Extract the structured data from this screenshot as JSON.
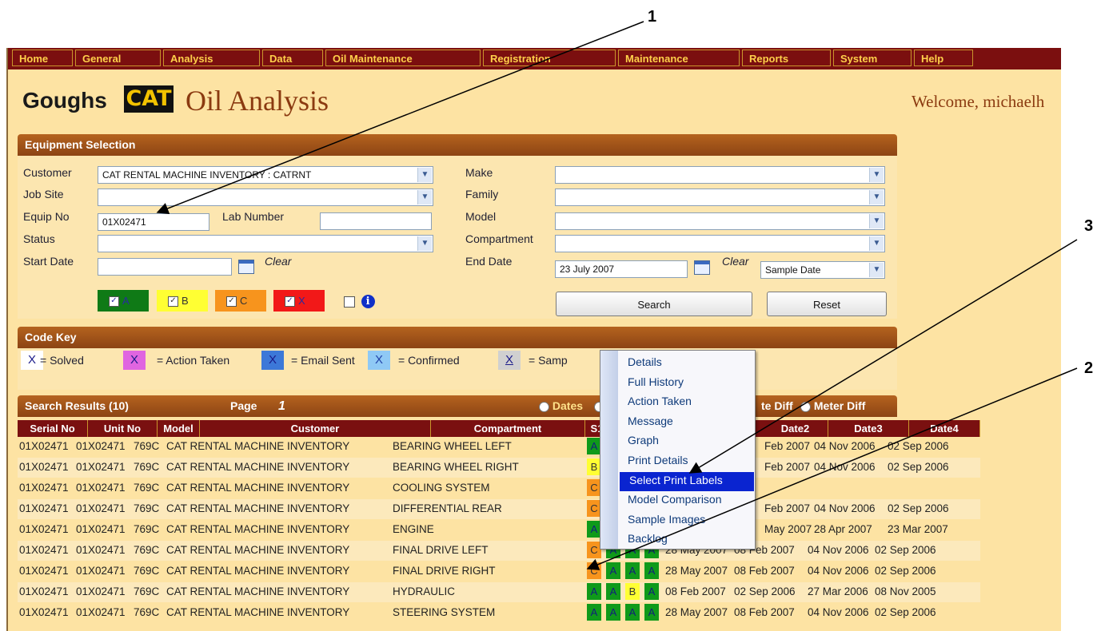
{
  "menu": [
    "Home",
    "General",
    "Analysis",
    "Data",
    "Oil Maintenance",
    "Registration",
    "Maintenance",
    "Reports",
    "System",
    "Help"
  ],
  "header": {
    "brand": "Goughs",
    "cat_logo": "CAT",
    "title": "Oil Analysis",
    "welcome": "Welcome, michaelh"
  },
  "equipment_selection": {
    "heading": "Equipment Selection",
    "customer_label": "Customer",
    "customer_value": "CAT RENTAL MACHINE INVENTORY : CATRNT",
    "job_site_label": "Job Site",
    "equip_no_label": "Equip No",
    "equip_no_value": "01X02471",
    "lab_number_label": "Lab Number",
    "status_label": "Status",
    "start_date_label": "Start Date",
    "make_label": "Make",
    "family_label": "Family",
    "model_label": "Model",
    "compartment_label": "Compartment",
    "end_date_label": "End Date",
    "end_date_value": "23 July 2007",
    "date_type_value": "Sample Date",
    "clear_label": "Clear",
    "filters": {
      "a": "A",
      "b": "B",
      "c": "C",
      "x": "X"
    },
    "filter_colors": {
      "a": "#0f7a16",
      "b": "#ffff33",
      "c": "#f7941d",
      "x": "#f21818"
    },
    "search_button": "Search",
    "reset_button": "Reset"
  },
  "code_key": {
    "heading": "Code Key",
    "symbol": "X",
    "items": [
      {
        "symbol": "X",
        "text": "= Solved",
        "color": "#ffffff"
      },
      {
        "symbol": "X",
        "text": "= Action Taken",
        "color": "#e065e0"
      },
      {
        "symbol": "X",
        "text": "= Email Sent",
        "color": "#3c78d8"
      },
      {
        "symbol": "X",
        "text": "= Confirmed",
        "color": "#8fc9f5"
      },
      {
        "symbol": "X",
        "text": "= Samp",
        "color": "#d0d0d0"
      }
    ]
  },
  "results": {
    "heading": "Search Results (10)",
    "page_label": "Page",
    "page_number": "1",
    "radio_dates": "Dates",
    "radio_date_diff": "te Diff",
    "radio_meter_diff": "Meter Diff",
    "columns": [
      "Serial No",
      "Unit No",
      "Model",
      "Customer",
      "Compartment",
      "S1",
      "Date2",
      "Date3",
      "Date4"
    ],
    "rows": [
      {
        "serial": "01X02471",
        "unit": "01X02471",
        "model": "769C",
        "customer": "CAT RENTAL MACHINE INVENTORY",
        "compartment": "BEARING WHEEL LEFT",
        "codes": [
          "A"
        ],
        "dates": [
          "Feb 2007",
          "04 Nov 2006",
          "02 Sep 2006"
        ]
      },
      {
        "serial": "01X02471",
        "unit": "01X02471",
        "model": "769C",
        "customer": "CAT RENTAL MACHINE INVENTORY",
        "compartment": "BEARING WHEEL RIGHT",
        "codes": [
          "B"
        ],
        "dates": [
          "Feb 2007",
          "04 Nov 2006",
          "02 Sep 2006"
        ]
      },
      {
        "serial": "01X02471",
        "unit": "01X02471",
        "model": "769C",
        "customer": "CAT RENTAL MACHINE INVENTORY",
        "compartment": "COOLING SYSTEM",
        "codes": [
          "C"
        ],
        "dates": [
          "",
          "",
          ""
        ]
      },
      {
        "serial": "01X02471",
        "unit": "01X02471",
        "model": "769C",
        "customer": "CAT RENTAL MACHINE INVENTORY",
        "compartment": "DIFFERENTIAL REAR",
        "codes": [
          "C"
        ],
        "dates": [
          "Feb 2007",
          "04 Nov 2006",
          "02 Sep 2006"
        ]
      },
      {
        "serial": "01X02471",
        "unit": "01X02471",
        "model": "769C",
        "customer": "CAT RENTAL MACHINE INVENTORY",
        "compartment": "ENGINE",
        "codes": [
          "A"
        ],
        "dates": [
          "May 2007",
          "28 Apr 2007",
          "23 Mar 2007"
        ]
      },
      {
        "serial": "01X02471",
        "unit": "01X02471",
        "model": "769C",
        "customer": "CAT RENTAL MACHINE INVENTORY",
        "compartment": "FINAL DRIVE LEFT",
        "codes": [
          "C",
          "A",
          "A",
          "A"
        ],
        "dates": [
          "28 May 2007",
          "08 Feb 2007",
          "04 Nov 2006",
          "02 Sep 2006"
        ]
      },
      {
        "serial": "01X02471",
        "unit": "01X02471",
        "model": "769C",
        "customer": "CAT RENTAL MACHINE INVENTORY",
        "compartment": "FINAL DRIVE RIGHT",
        "codes": [
          "C",
          "A",
          "A",
          "A"
        ],
        "dates": [
          "28 May 2007",
          "08 Feb 2007",
          "04 Nov 2006",
          "02 Sep 2006"
        ]
      },
      {
        "serial": "01X02471",
        "unit": "01X02471",
        "model": "769C",
        "customer": "CAT RENTAL MACHINE INVENTORY",
        "compartment": "HYDRAULIC",
        "codes": [
          "A",
          "A",
          "B",
          "A"
        ],
        "dates": [
          "08 Feb 2007",
          "02 Sep 2006",
          "27 Mar 2006",
          "08 Nov 2005"
        ]
      },
      {
        "serial": "01X02471",
        "unit": "01X02471",
        "model": "769C",
        "customer": "CAT RENTAL MACHINE INVENTORY",
        "compartment": "STEERING SYSTEM",
        "codes": [
          "A",
          "A",
          "A",
          "A"
        ],
        "dates": [
          "28 May 2007",
          "08 Feb 2007",
          "04 Nov 2006",
          "02 Sep 2006"
        ]
      }
    ],
    "code_colors": {
      "A": "#0f9a1a",
      "B": "#ffff33",
      "C": "#f7941d"
    },
    "row_colors": [
      "#fde3a3",
      "#fce9bc"
    ]
  },
  "context_menu": {
    "items": [
      "Details",
      "Full History",
      "Action Taken",
      "Message",
      "Graph",
      "Print Details",
      "Select Print Labels",
      "Model Comparison",
      "Sample Images",
      "Backlog"
    ],
    "selected": "Select Print Labels"
  },
  "callouts": [
    "1",
    "2",
    "3"
  ]
}
